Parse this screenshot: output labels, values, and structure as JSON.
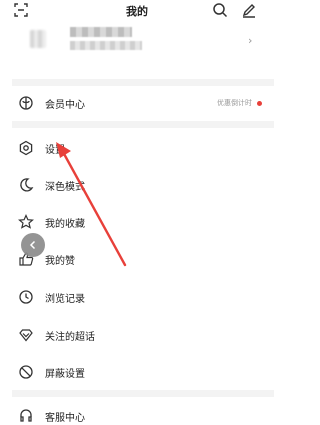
{
  "header": {
    "title": "我的",
    "scan_icon": "scan-icon",
    "search_icon": "search-icon",
    "edit_icon": "edit-icon"
  },
  "profile": {
    "chevron": "›"
  },
  "menu": {
    "member": {
      "label": "会员中心",
      "right": "优惠倒计时",
      "icon": "member-icon"
    },
    "settings": {
      "label": "设置",
      "icon": "settings-gear-icon"
    },
    "dark_mode": {
      "label": "深色模式",
      "icon": "moon-icon"
    },
    "favorites": {
      "label": "我的收藏",
      "icon": "star-icon"
    },
    "likes": {
      "label": "我的赞",
      "icon": "thumb-up-icon"
    },
    "history": {
      "label": "浏览记录",
      "icon": "clock-icon"
    },
    "super_topics": {
      "label": "关注的超话",
      "icon": "diamond-icon"
    },
    "block_settings": {
      "label": "屏蔽设置",
      "icon": "block-icon"
    },
    "support": {
      "label": "客服中心",
      "icon": "headset-icon"
    }
  },
  "colors": {
    "badge_dot": "#e8403a",
    "arrow": "#e8403a",
    "separator": "#f3f3f3"
  }
}
